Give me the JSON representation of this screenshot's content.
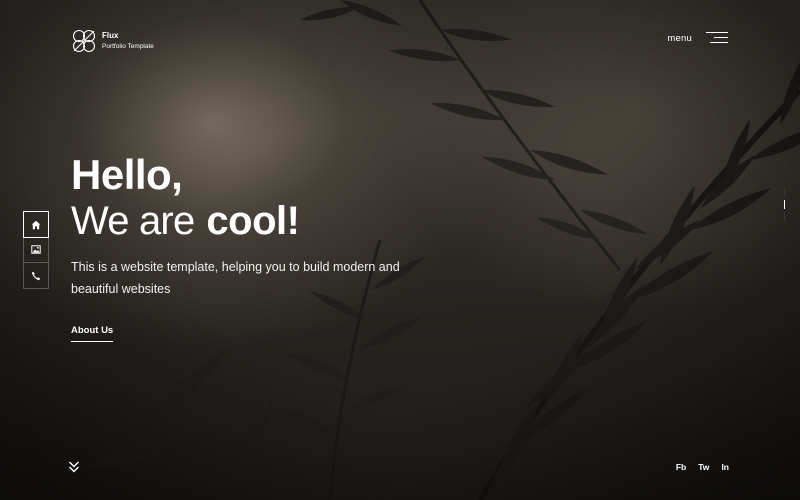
{
  "brand": {
    "name": "Flux",
    "tagline": "Portfolio Template"
  },
  "menu": {
    "label": "menu"
  },
  "side_nav": {
    "items": [
      {
        "icon": "home-icon",
        "active": true
      },
      {
        "icon": "image-icon",
        "active": false
      },
      {
        "icon": "phone-icon",
        "active": false
      }
    ]
  },
  "hero": {
    "line1": "Hello,",
    "line2_light": "We are",
    "line2_bold": "cool!",
    "description": "This is a website template, helping you to build modern and beautiful websites",
    "cta_label": "About Us"
  },
  "pager": {
    "active_index": 1
  },
  "social": {
    "items": [
      "Fb",
      "Tw",
      "In"
    ]
  },
  "colors": {
    "text": "#ffffff",
    "background": "#2a2622"
  }
}
